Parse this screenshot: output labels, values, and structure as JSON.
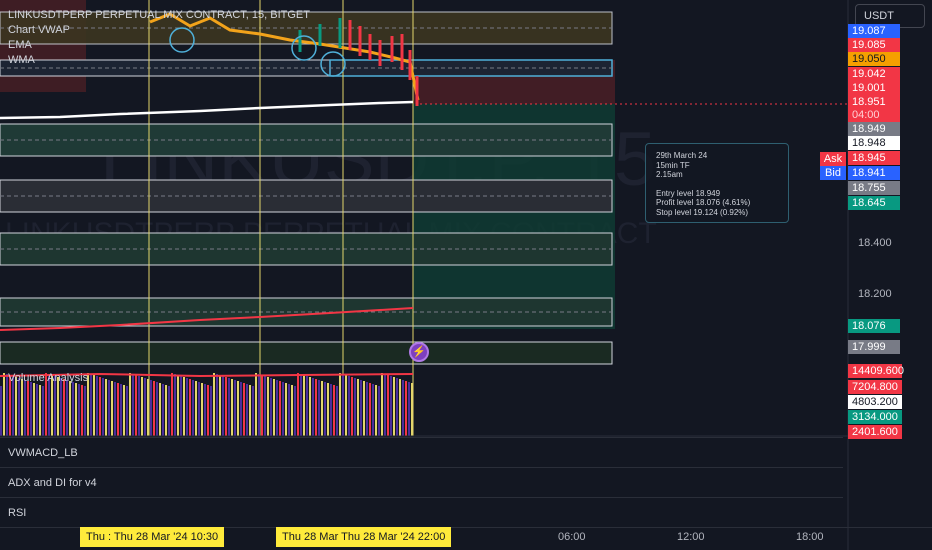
{
  "chart": {
    "symbol_line": "LINKUSDTPERP PERPETUAL MIX CONTRACT, 15, BITGET",
    "watermark_big": "LINKUSDT.P, 15",
    "watermark_small": "LINKUSDTPERP PERPETUAL MIX CONTRACT",
    "indicators": [
      "Chart VWAP",
      "EMA",
      "WMA"
    ],
    "currency": "USDT",
    "colors": {
      "background": "#131722",
      "zone_green": "#0f3b33",
      "zone_red": "#4a1f26",
      "vertical_line": "#e3d56b",
      "ema": "#f2a31b",
      "vwap": "#ffffff",
      "wma": "#f23645"
    }
  },
  "price_axis": {
    "tags": [
      {
        "label": "19.087",
        "bg": "#2962ff",
        "fg": "#ffffff"
      },
      {
        "label": "19.085",
        "bg": "#f23645",
        "fg": "#ffffff"
      },
      {
        "label": "19.050",
        "bg": "#f59f00",
        "fg": "#131722"
      },
      {
        "label": "19.042",
        "bg": "#f23645",
        "fg": "#ffffff"
      },
      {
        "label": "19.001",
        "bg": "#f23645",
        "fg": "#ffffff"
      },
      {
        "label": "18.951",
        "bg": "#f23645",
        "fg": "#ffffff"
      },
      {
        "label": "04:00",
        "bg": "#f23645",
        "fg": "#ffd0d4"
      },
      {
        "label": "18.949",
        "bg": "#787b86",
        "fg": "#ffffff"
      },
      {
        "label": "18.948",
        "bg": "#ffffff",
        "fg": "#131722"
      },
      {
        "label": "18.945",
        "bg": "#f23645",
        "fg": "#ffffff"
      },
      {
        "label": "18.941",
        "bg": "#2962ff",
        "fg": "#ffffff"
      },
      {
        "label": "18.755",
        "bg": "#787b86",
        "fg": "#ffffff"
      },
      {
        "label": "18.645",
        "bg": "#089981",
        "fg": "#ffffff"
      },
      {
        "label": "18.076",
        "bg": "#089981",
        "fg": "#ffffff"
      },
      {
        "label": "17.999",
        "bg": "#787b86",
        "fg": "#ffffff"
      }
    ],
    "ask": "Ask",
    "bid": "Bid",
    "scale": [
      "18.400",
      "18.200"
    ]
  },
  "trade_note": {
    "date": "29th March 24",
    "tf": "15min TF",
    "time": "2.15am",
    "entry": "Entry level 18.949",
    "profit": "Profit level 18.076 (4.61%)",
    "stop": "Stop level 19.124 (0.92%)"
  },
  "volume_pane": {
    "title": "Volume Analysis",
    "tags": [
      {
        "label": "14409.600",
        "bg": "#f23645",
        "fg": "#ffffff"
      },
      {
        "label": "7204.800",
        "bg": "#f23645",
        "fg": "#ffffff"
      },
      {
        "label": "4803.200",
        "bg": "#ffffff",
        "fg": "#131722"
      },
      {
        "label": "3134.000",
        "bg": "#089981",
        "fg": "#ffffff"
      },
      {
        "label": "2401.600",
        "bg": "#f23645",
        "fg": "#ffffff"
      }
    ]
  },
  "panes": [
    "VWMACD_LB",
    "ADX and DI for v4",
    "RSI"
  ],
  "time_axis": {
    "highlight1": "Thu :  Thu 28 Mar '24   10:30",
    "highlight2": "Thu 28 Mar   Thu 28 Mar '24   22:00",
    "ticks": [
      "06:00",
      "12:00",
      "18:00"
    ]
  }
}
